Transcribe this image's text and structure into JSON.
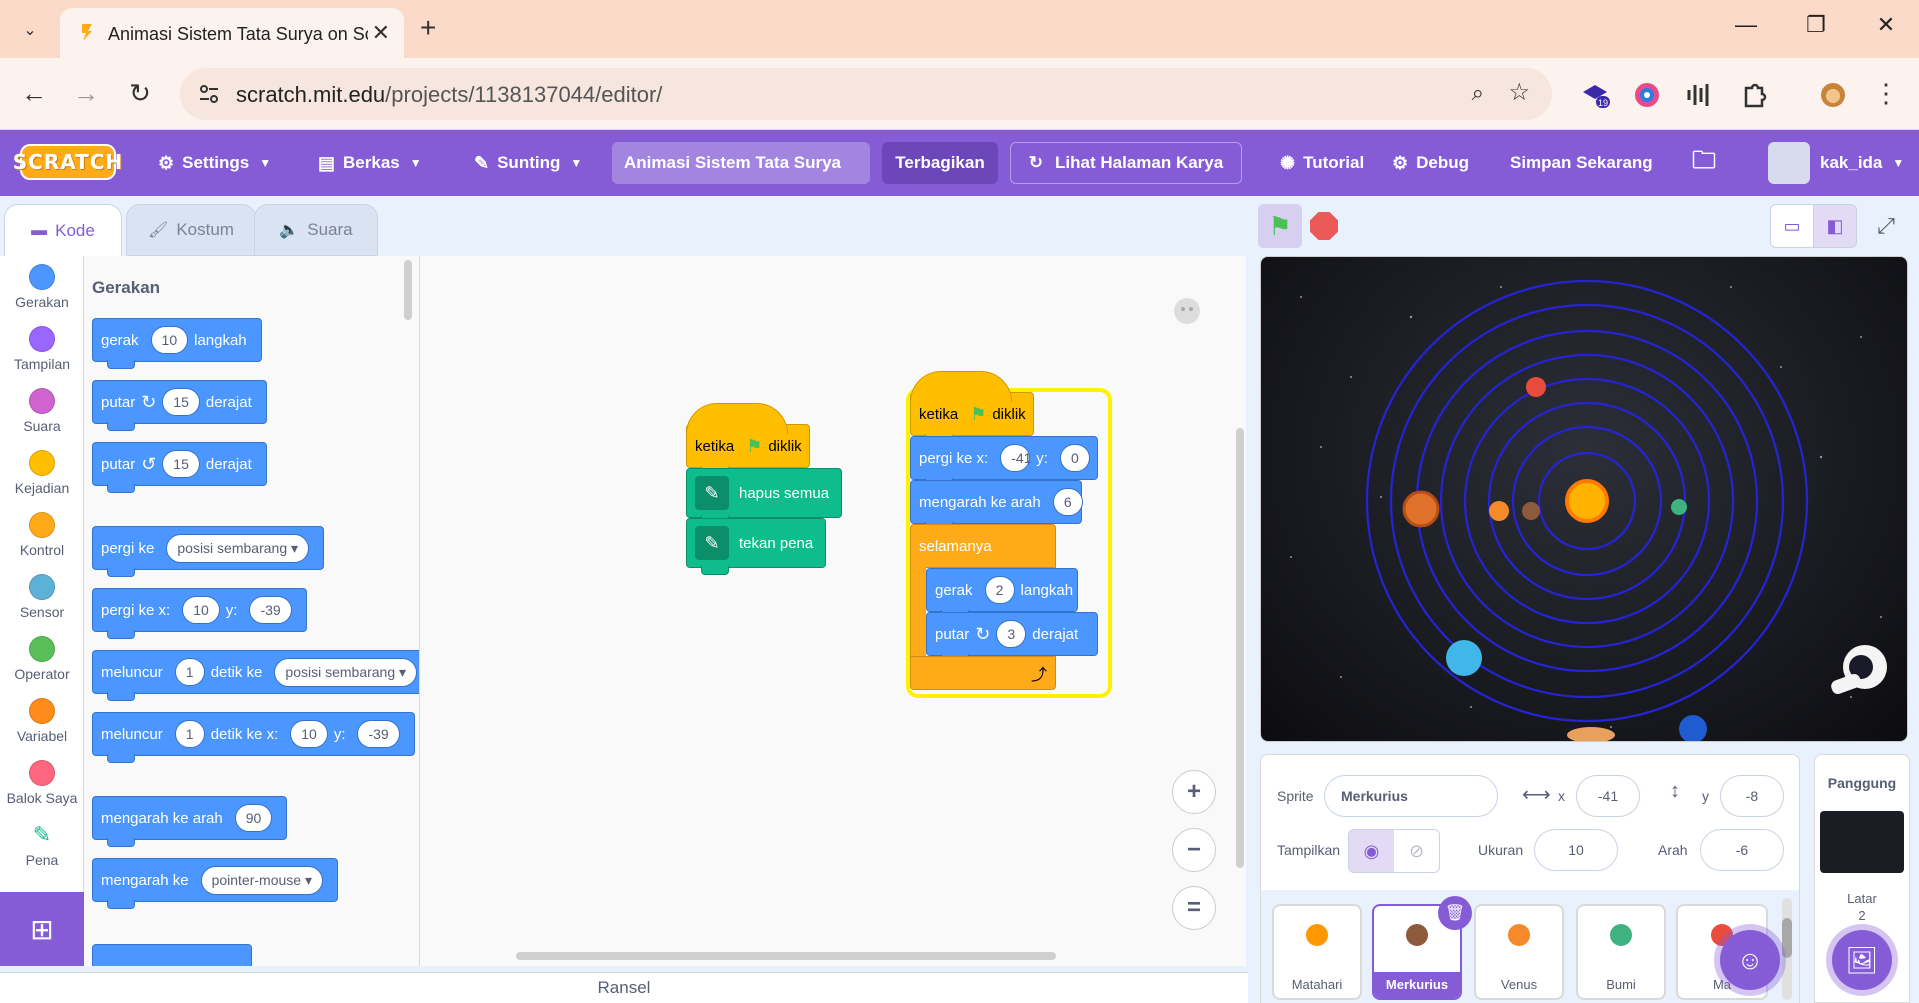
{
  "browser": {
    "tab_title": "Animasi Sistem Tata Surya on Sc",
    "url_host": "scratch.mit.edu",
    "url_path": "/projects/1138137044/editor/",
    "extension_badge": "19"
  },
  "menubar": {
    "logo": "SCRATCH",
    "settings": "Settings",
    "file": "Berkas",
    "edit": "Sunting",
    "project_title": "Animasi Sistem Tata Surya",
    "share": "Terbagikan",
    "see_project": "Lihat Halaman Karya",
    "tutorial": "Tutorial",
    "debug": "Debug",
    "save_now": "Simpan Sekarang",
    "username": "kak_ida"
  },
  "editor_tabs": {
    "code": "Kode",
    "costumes": "Kostum",
    "sounds": "Suara"
  },
  "categories": [
    {
      "label": "Gerakan",
      "color": "#4c97ff"
    },
    {
      "label": "Tampilan",
      "color": "#9966ff"
    },
    {
      "label": "Suara",
      "color": "#cf63cf"
    },
    {
      "label": "Kejadian",
      "color": "#ffbf00"
    },
    {
      "label": "Kontrol",
      "color": "#ffab19"
    },
    {
      "label": "Sensor",
      "color": "#5cb1d6"
    },
    {
      "label": "Operator",
      "color": "#59c059"
    },
    {
      "label": "Variabel",
      "color": "#ff8c1a"
    },
    {
      "label": "Balok Saya",
      "color": "#ff6680"
    },
    {
      "label": "Pena",
      "color": "#0fbd8c"
    }
  ],
  "palette": {
    "heading": "Gerakan",
    "move": {
      "a": "gerak",
      "val": "10",
      "b": "langkah"
    },
    "turn_right": {
      "a": "putar",
      "val": "15",
      "b": "derajat"
    },
    "turn_left": {
      "a": "putar",
      "val": "15",
      "b": "derajat"
    },
    "goto": {
      "a": "pergi ke",
      "drop": "posisi sembarang"
    },
    "goto_xy": {
      "a": "pergi ke x:",
      "x": "10",
      "b": "y:",
      "y": "-39"
    },
    "glide": {
      "a": "meluncur",
      "val": "1",
      "b": "detik ke",
      "drop": "posisi sembarang"
    },
    "glide_xy": {
      "a": "meluncur",
      "val": "1",
      "b": "detik ke x:",
      "x": "10",
      "c": "y:",
      "y": "-39"
    },
    "point_dir": {
      "a": "mengarah ke arah",
      "val": "90"
    },
    "point_to": {
      "a": "mengarah ke",
      "drop": "pointer-mouse"
    }
  },
  "script1": {
    "hat": {
      "a": "ketika",
      "b": "diklik"
    },
    "clear": "hapus semua",
    "pen_down": "tekan pena"
  },
  "script2": {
    "hat": {
      "a": "ketika",
      "b": "diklik"
    },
    "goto": {
      "a": "pergi ke x:",
      "x": "-41",
      "b": "y:",
      "y": "0"
    },
    "dir": {
      "a": "mengarah ke arah",
      "val": "6"
    },
    "forever": "selamanya",
    "move": {
      "a": "gerak",
      "val": "2",
      "b": "langkah"
    },
    "turn": {
      "a": "putar",
      "val": "3",
      "b": "derajat"
    }
  },
  "backpack": "Ransel",
  "sprite_info": {
    "sprite_label": "Sprite",
    "sprite_name": "Merkurius",
    "x_label": "x",
    "x": "-41",
    "y_label": "y",
    "y": "-8",
    "show_label": "Tampilkan",
    "size_label": "Ukuran",
    "size": "10",
    "direction_label": "Arah",
    "direction": "-6"
  },
  "sprites": [
    {
      "name": "Matahari",
      "color": "#ff9800"
    },
    {
      "name": "Merkurius",
      "color": "#8d5a3b"
    },
    {
      "name": "Venus",
      "color": "#f58a2a"
    },
    {
      "name": "Bumi",
      "color": "#3fb37f"
    },
    {
      "name": "Ma",
      "color": "#e94b3c"
    }
  ],
  "stage_target": {
    "title": "Panggung",
    "backdrop_label": "Latar",
    "backdrop_count": "2"
  },
  "icons": {
    "flag": "green-flag-icon",
    "stop": "stop-icon"
  }
}
